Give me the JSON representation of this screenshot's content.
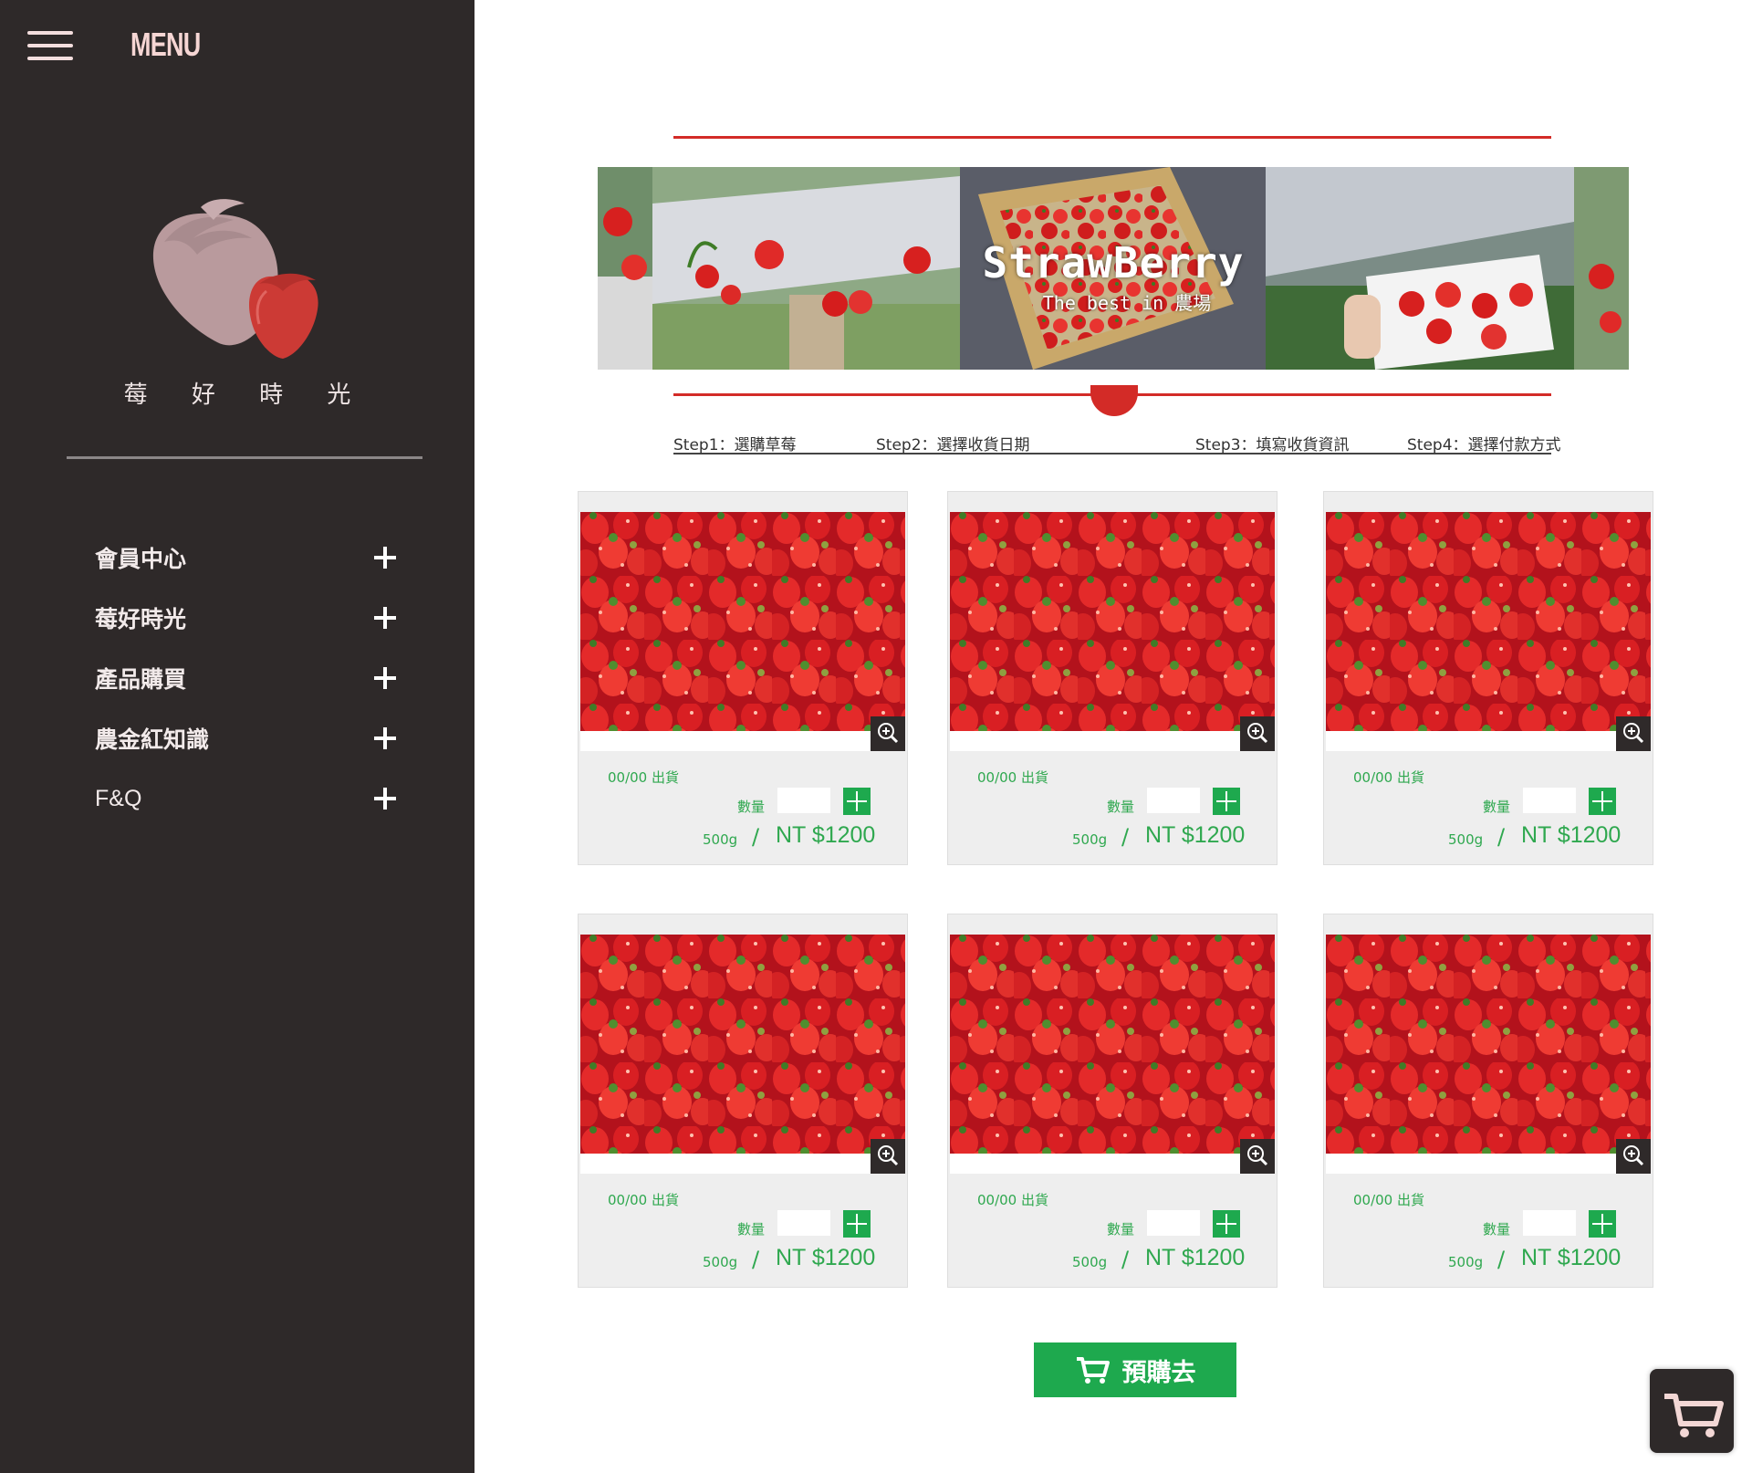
{
  "sidebar": {
    "menu_label": "MENU",
    "brand": "莓 好 時 光",
    "items": [
      {
        "label": "會員中心"
      },
      {
        "label": "莓好時光"
      },
      {
        "label": "產品購買"
      },
      {
        "label": "農金紅知識"
      },
      {
        "label": "F&Q"
      }
    ]
  },
  "banner": {
    "title": "StrawBerry",
    "subtitle": "The best in 農場"
  },
  "steps": [
    {
      "label": "Step1：選購草莓"
    },
    {
      "label": "Step2：選擇收貨日期"
    },
    {
      "label": "Step3：填寫收貨資訊"
    },
    {
      "label": "Step4：選擇付款方式"
    }
  ],
  "products": [
    {
      "ship": "00/00 出貨",
      "qty_label": "數量",
      "qty_value": "",
      "weight": "500g",
      "slash": "/",
      "price": "NT $1200"
    },
    {
      "ship": "00/00 出貨",
      "qty_label": "數量",
      "qty_value": "",
      "weight": "500g",
      "slash": "/",
      "price": "NT $1200"
    },
    {
      "ship": "00/00 出貨",
      "qty_label": "數量",
      "qty_value": "",
      "weight": "500g",
      "slash": "/",
      "price": "NT $1200"
    },
    {
      "ship": "00/00 出貨",
      "qty_label": "數量",
      "qty_value": "",
      "weight": "500g",
      "slash": "/",
      "price": "NT $1200"
    },
    {
      "ship": "00/00 出貨",
      "qty_label": "數量",
      "qty_value": "",
      "weight": "500g",
      "slash": "/",
      "price": "NT $1200"
    },
    {
      "ship": "00/00 出貨",
      "qty_label": "數量",
      "qty_value": "",
      "weight": "500g",
      "slash": "/",
      "price": "NT $1200"
    }
  ],
  "preorder_label": "預購去",
  "icons": {
    "hamburger": "hamburger-icon",
    "logo": "strawberry-logo",
    "nav_expand": "plus-icon",
    "zoom": "zoom-in-icon",
    "qty_add": "plus-icon",
    "cart": "cart-icon"
  },
  "colors": {
    "sidebar_bg": "#2e2929",
    "accent_red": "#d32b27",
    "accent_green": "#1ea94e",
    "text_green": "#2fa84f",
    "logo_pink": "#b99a9d",
    "logo_red": "#cc3a35"
  }
}
